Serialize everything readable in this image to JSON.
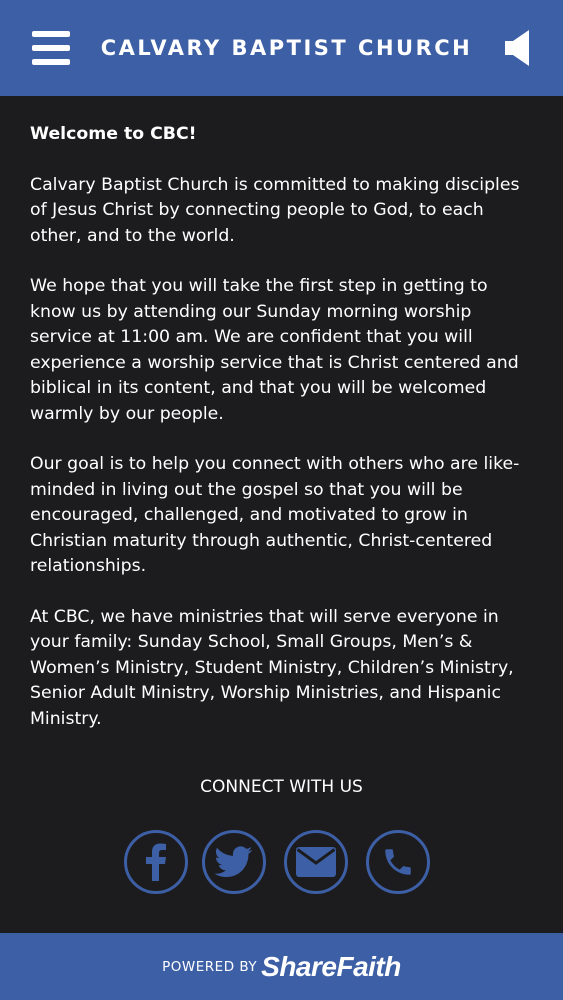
{
  "header": {
    "title": "CALVARY BAPTIST CHURCH",
    "menu_icon": "hamburger-menu-icon",
    "audio_icon": "speaker-icon"
  },
  "content": {
    "welcome": "Welcome to CBC!",
    "paragraphs": [
      "Calvary Baptist Church is committed to making disciples of Jesus Christ by connecting people to God, to each other, and to the world.",
      "We hope that you will take the first step in getting to know us by attending our Sunday morning worship service at 11:00 am. We are confident that you will experience a worship service that is Christ centered and biblical in its content, and that you will be welcomed warmly by our people.",
      "Our goal is to help you connect with others who are like-minded in living out the gospel so that you will be encouraged, challenged, and motivated to grow in Christian maturity through authentic, Christ-centered relationships.",
      "At CBC, we have ministries that will serve everyone in your family: Sunday School, Small Groups, Men’s & Women’s Ministry, Student Ministry, Children’s Ministry, Senior Adult Ministry, Worship Ministries, and Hispanic Ministry."
    ]
  },
  "connect": {
    "label": "CONNECT WITH US",
    "icons": [
      "facebook-icon",
      "twitter-icon",
      "email-icon",
      "phone-icon"
    ]
  },
  "footer": {
    "powered_by": "POWERED BY",
    "brand": "ShareFaith"
  },
  "colors": {
    "accent": "#3d5fa6",
    "background": "#1c1c1e",
    "text": "#ffffff"
  }
}
